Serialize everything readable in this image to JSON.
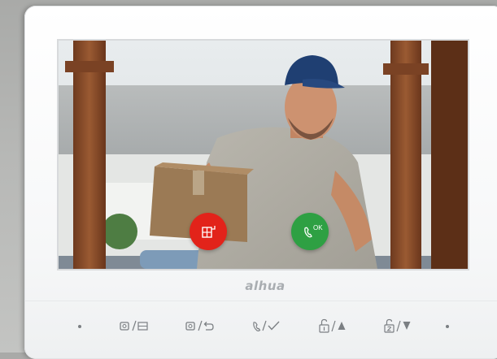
{
  "brand": {
    "logo_text": "alhua"
  },
  "screen": {
    "unlock_button": {
      "icon": "door-unlock-icon"
    },
    "answer_button": {
      "icon": "phone-answer-icon",
      "label": "OK"
    }
  },
  "bottom_keys": [
    {
      "name": "monitor-record-key",
      "icon": "camera-record-icon"
    },
    {
      "name": "monitor-back-key",
      "icon": "camera-back-icon"
    },
    {
      "name": "talk-confirm-key",
      "icon": "phone-check-icon"
    },
    {
      "name": "unlock1-up-key",
      "icon": "lock1-up-icon"
    },
    {
      "name": "unlock2-down-key",
      "icon": "lock2-down-icon"
    }
  ],
  "colors": {
    "unlock": "#e2231a",
    "answer": "#2ea043",
    "bezel": "#ffffff",
    "icon_gray": "#7b7f83"
  }
}
